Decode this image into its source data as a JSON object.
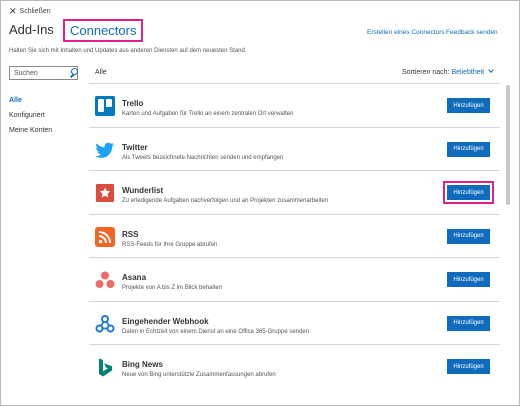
{
  "header": {
    "close_label": "Schließen",
    "tab_addins": "Add-Ins",
    "tab_connectors": "Connectors",
    "create_connector_link": "Erstellen eines Connectors",
    "feedback_link": "Feedback senden",
    "description": "Halten Sie sich mit Inhalten und Updates aus anderen Diensten auf dem neuesten Stand."
  },
  "search": {
    "placeholder": "Suchen"
  },
  "sidebar": {
    "items": [
      {
        "label": "Alle"
      },
      {
        "label": "Konfiguriert"
      },
      {
        "label": "Meine Konten"
      }
    ]
  },
  "list_header": {
    "filter_label": "Alle",
    "sort_label": "Sortieren nach:",
    "sort_value": "Beliebtheit"
  },
  "connectors": [
    {
      "name": "Trello",
      "desc": "Karten und Aufgaben für Trello an einem zentralen Ort verwalten",
      "button": "Hinzufügen",
      "icon": "trello-icon"
    },
    {
      "name": "Twitter",
      "desc": "Als Tweets bezeichnete Nachrichten senden und empfangen",
      "button": "Hinzufügen",
      "icon": "twitter-icon"
    },
    {
      "name": "Wunderlist",
      "desc": "Zu erledigende Aufgaben nachverfolgen und an Projekten zusammenarbeiten",
      "button": "Hinzufügen",
      "icon": "wunderlist-icon"
    },
    {
      "name": "RSS",
      "desc": "RSS-Feeds für Ihre Gruppe abrufen",
      "button": "Hinzufügen",
      "icon": "rss-icon"
    },
    {
      "name": "Asana",
      "desc": "Projekte von A bis Z im Blick behalten",
      "button": "Hinzufügen",
      "icon": "asana-icon"
    },
    {
      "name": "Eingehender Webhook",
      "desc": "Daten in Echtzeit von einem Dienst an eine Office 365-Gruppe senden",
      "button": "Hinzufügen",
      "icon": "webhook-icon"
    },
    {
      "name": "Bing News",
      "desc": "Neue von Bing unterstützte Zusammenfassungen abrufen",
      "button": "Hinzufügen",
      "icon": "bing-icon"
    }
  ],
  "colors": {
    "accent": "#0f6cbd",
    "highlight": "#e0218a"
  }
}
